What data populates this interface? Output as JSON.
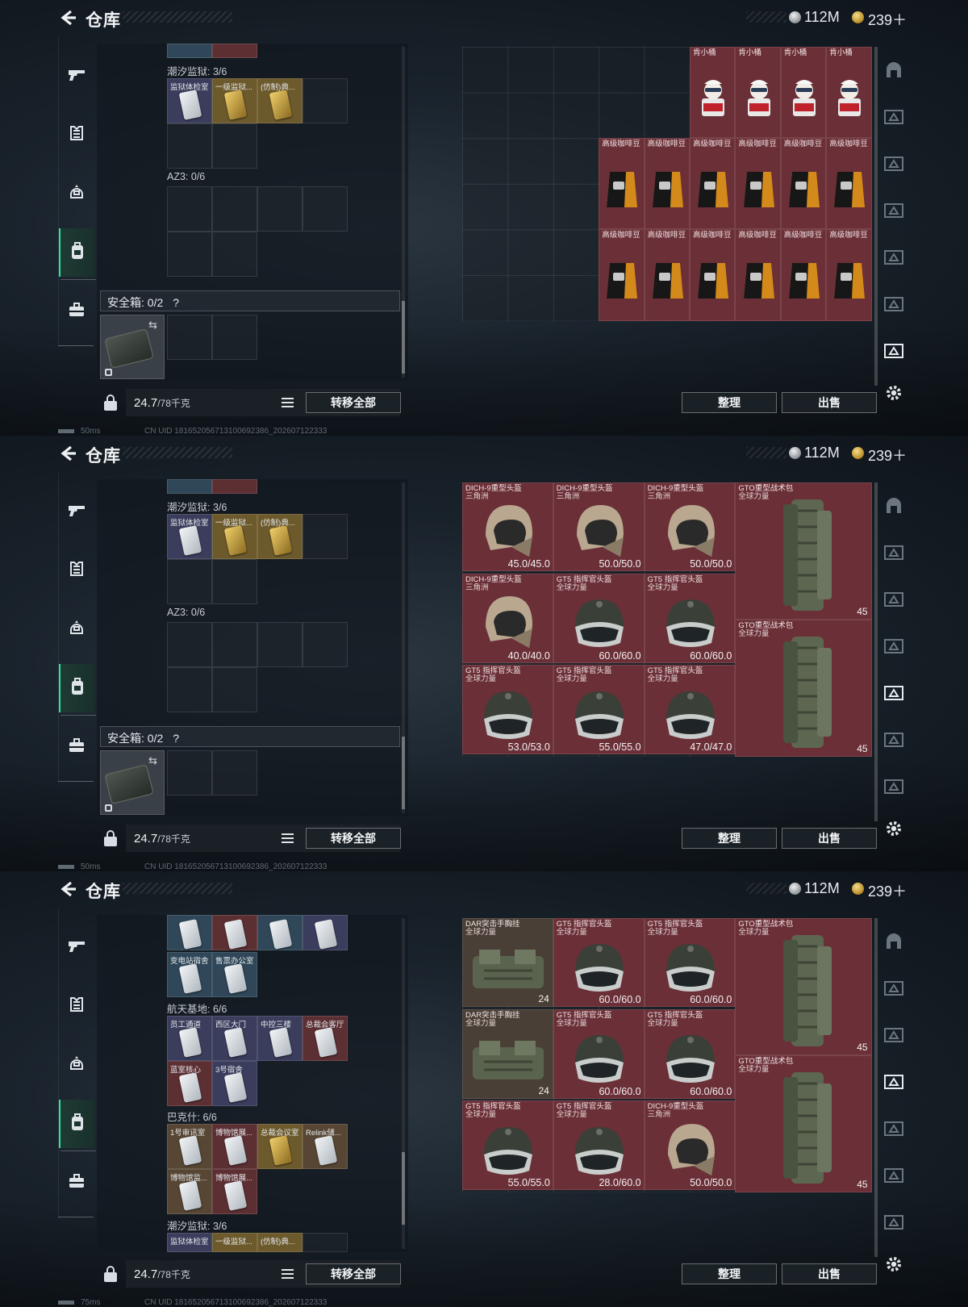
{
  "header": {
    "title": "仓库",
    "silver": "112M",
    "gold": "239＋"
  },
  "left": {
    "prison_label": "潮汐监狱: 3/6",
    "az3_label": "AZ3: 0/6",
    "spacebase_label": "航天基地: 6/6",
    "baks_label": "巴克什: 6/6",
    "safe_label": "安全箱: 0/2",
    "safe_help": "?",
    "weight_value": "24.7",
    "weight_max": "/78千克",
    "transfer_all": "转移全部",
    "prison_keys": [
      "监狱体检室",
      "一级监狱...",
      "(仿制)典..."
    ],
    "top_keys": [
      "变电站宿舍",
      "售票办公室"
    ],
    "spacebase_keys": [
      "员工通道",
      "西区大门",
      "中控三楼",
      "总裁会客厅",
      "蓝室核心",
      "3号宿舍"
    ],
    "baks_keys": [
      "1号审讯室",
      "博物馆展...",
      "总裁会议室",
      "Relink储...",
      "博物馆监...",
      "博物馆展..."
    ]
  },
  "right": {
    "sort": "整理",
    "sell": "出售",
    "kfc": "肯小桶",
    "coffee": "高级咖啡豆",
    "dich": "DICH-9重型头盔",
    "gt5": "GT5 指挥官头盔",
    "gto": "GTO重型战术包",
    "dar": "DAR突击手胸挂",
    "sanjiaozhou": "三角洲",
    "global": "全球力量",
    "s2_vals": [
      "45.0/45.0",
      "50.0/50.0",
      "50.0/50.0",
      "40.0/40.0",
      "60.0/60.0",
      "60.0/60.0",
      "53.0/53.0",
      "55.0/55.0",
      "47.0/47.0"
    ],
    "s3_vals": [
      "60.0/60.0",
      "60.0/60.0",
      "60.0/60.0",
      "60.0/60.0",
      "55.0/55.0",
      "28.0/60.0",
      "50.0/50.0"
    ],
    "bag_cap": "45",
    "dar_cap": "24"
  },
  "status": [
    {
      "ping": "50ms",
      "uid": "CN UID 1816520567131006923​86_202607122333"
    },
    {
      "ping": "50ms",
      "uid": "CN UID 1816520567131006923​86_202607122333"
    },
    {
      "ping": "75ms",
      "uid": "CN UID 1816520567131006923​86_202607122333"
    }
  ],
  "colors": {
    "accent": "#2ee39a",
    "item_red": "#6b2f37",
    "item_brown": "#4a3f36"
  },
  "icons": [
    "back-arrow-icon",
    "silver-coin-icon",
    "gold-coin-icon",
    "gun-icon",
    "armor-icon",
    "helmet-icon",
    "backpack-icon",
    "briefcase-icon",
    "lock-icon",
    "list-icon",
    "gear-icon",
    "swap-icon"
  ]
}
